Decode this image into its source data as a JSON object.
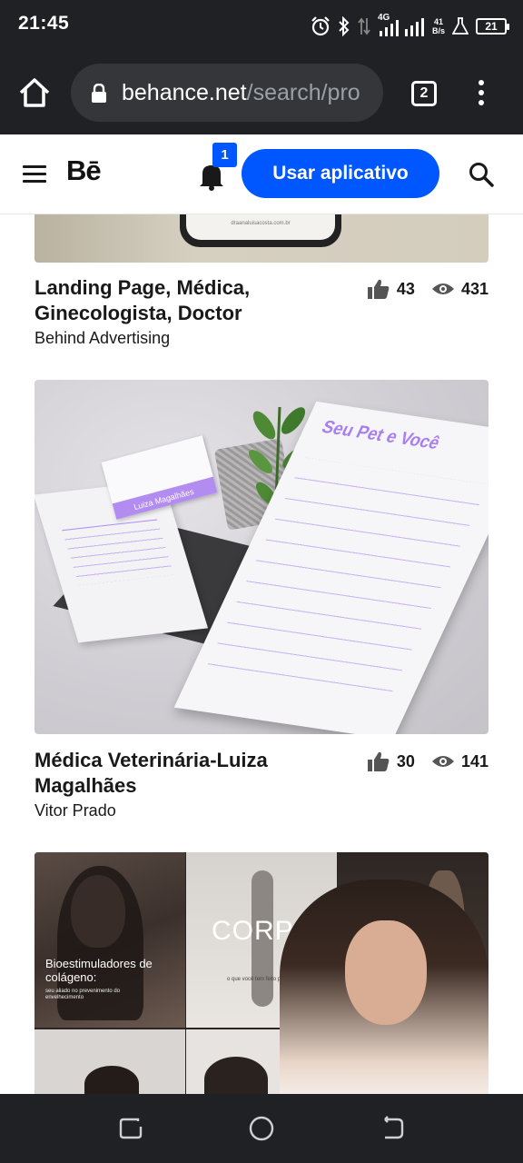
{
  "status_bar": {
    "time": "21:45",
    "network_type": "4G",
    "speed_value": "41",
    "speed_unit": "B/s",
    "battery": "21"
  },
  "browser": {
    "url_domain": "behance.net",
    "url_path": "/search/pro",
    "tab_count": "2"
  },
  "header": {
    "logo": "Bē",
    "notification_count": "1",
    "use_app_label": "Usar aplicativo"
  },
  "projects": [
    {
      "title": "Landing Page, Médica, Ginecologista, Doctor",
      "owner": "Behind Advertising",
      "likes": "43",
      "views": "431",
      "thumb_caption": "draanaluisacosta.com.br"
    },
    {
      "title": "Médica Veterinária-Luiza Magalhães",
      "owner": "Vitor Prado",
      "likes": "30",
      "views": "141",
      "thumb_texts": {
        "letterhead_title": "Seu Pet e Você",
        "card_name": "Luiza Magalhães"
      }
    },
    {
      "thumb_texts": {
        "panel1_heading": "Bioestimuladores de colágeno:",
        "panel1_sub": "seu aliado no prevenimento do envelhecimento",
        "panel2_heading": "CORPO",
        "panel2_sub": "o que você tem feito por ele?"
      }
    }
  ],
  "colors": {
    "brand_blue": "#0057ff",
    "chrome_dark": "#202124",
    "text": "#191919",
    "purple_accent": "#b38cf2"
  }
}
